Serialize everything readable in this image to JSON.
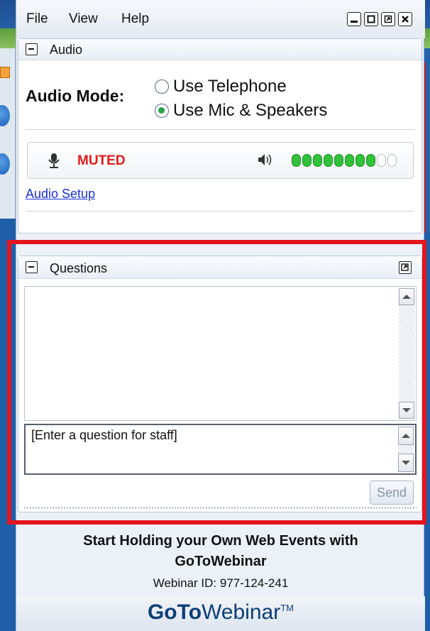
{
  "menu": {
    "file": "File",
    "view": "View",
    "help": "Help"
  },
  "audio": {
    "section_title": "Audio",
    "mode_label": "Audio Mode:",
    "options": [
      {
        "label": "Use Telephone",
        "selected": false
      },
      {
        "label": "Use Mic & Speakers",
        "selected": true
      }
    ],
    "mic_status": "MUTED",
    "speaker_level": {
      "filled": 8,
      "total": 10
    },
    "setup_link": "Audio Setup"
  },
  "questions": {
    "section_title": "Questions",
    "input_value": "[Enter a question for staff]",
    "send_label": "Send"
  },
  "promo": {
    "line1": "Start Holding your Own Web Events with",
    "line2": "GoToWebinar",
    "webinar_id": "Webinar ID: 977-124-241",
    "brand_goto": "GoTo",
    "brand_webinar": "Webinar",
    "brand_tm": "TM"
  },
  "colors": {
    "muted_red": "#e21a1a",
    "link_blue": "#1a2fd8",
    "level_green": "#2fc23a",
    "highlight_red": "#e3141d",
    "brand_navy": "#0c3e7a"
  }
}
